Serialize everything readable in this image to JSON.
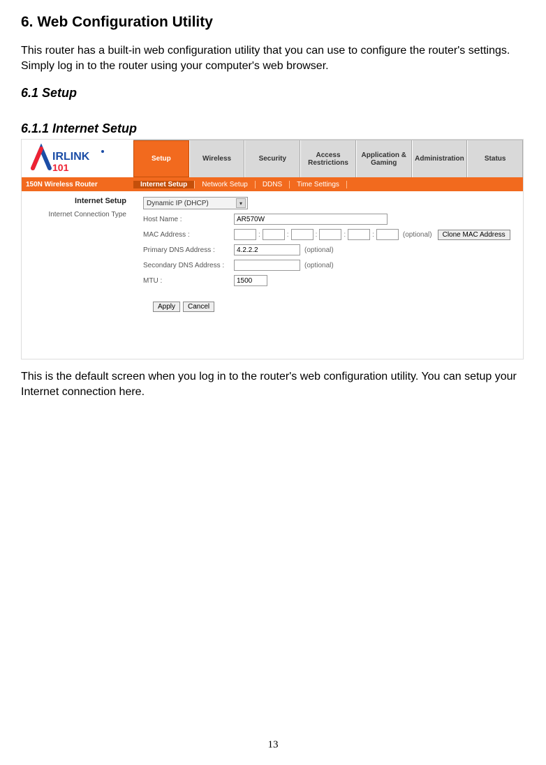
{
  "doc": {
    "heading_main": "6. Web Configuration Utility",
    "intro": "This router has a built-in web configuration utility that you can use to configure the router's settings. Simply log in to the router using your computer's web browser.",
    "heading_setup": "6.1 Setup",
    "heading_internet_setup": "6.1.1 Internet Setup",
    "caption": "This is the default screen when you log in to the router's web configuration utility. You can setup your Internet connection here.",
    "page_number": "13"
  },
  "router": {
    "brand_top": "IRLINK",
    "brand_sub": "101",
    "model": "150N Wireless Router",
    "tabs": {
      "setup": "Setup",
      "wireless": "Wireless",
      "security": "Security",
      "access": "Access\nRestrictions",
      "app": "Application &\nGaming",
      "admin": "Administration",
      "status": "Status"
    },
    "subtabs": {
      "internet": "Internet Setup",
      "network": "Network Setup",
      "ddns": "DDNS",
      "time": "Time Settings"
    },
    "section": {
      "title": "Internet Setup",
      "conn_type_label": "Internet Connection Type"
    },
    "form": {
      "conn_type_value": "Dynamic IP (DHCP)",
      "host_label": "Host Name :",
      "host_value": "AR570W",
      "mac_label": "MAC Address :",
      "mac_note": "(optional)",
      "clone_btn": "Clone MAC Address",
      "pdns_label": "Primary DNS Address :",
      "pdns_value": "4.2.2.2",
      "pdns_note": "(optional)",
      "sdns_label": "Secondary DNS Address :",
      "sdns_note": "(optional)",
      "mtu_label": "MTU :",
      "mtu_value": "1500",
      "apply": "Apply",
      "cancel": "Cancel"
    }
  }
}
